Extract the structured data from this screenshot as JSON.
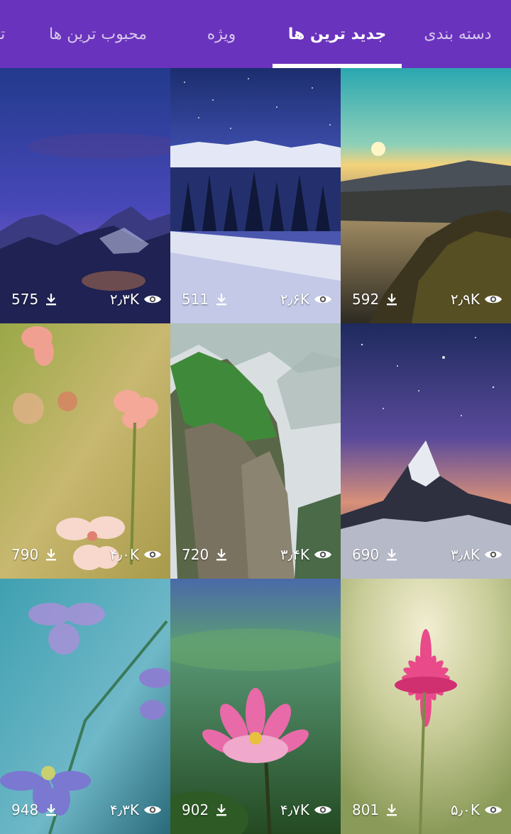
{
  "tabs": [
    {
      "label": "دسته بندی",
      "active": false
    },
    {
      "label": "جدید ترین ها",
      "active": true
    },
    {
      "label": "ویژه",
      "active": false
    },
    {
      "label": "محبوب ترین ها",
      "active": false
    },
    {
      "label": "تـ",
      "active": false
    }
  ],
  "colors": {
    "tab_bar": "#6a33bd",
    "indicator": "#ffffff"
  },
  "wallpapers": [
    {
      "subject": "purple night sky over mountain peaks",
      "downloads": "575",
      "views": "۲٫۳K",
      "download_icon": "download-icon",
      "view_icon": "eye-icon"
    },
    {
      "subject": "starry sky over snowy pine forest",
      "downloads": "511",
      "views": "۲٫۶K",
      "download_icon": "download-icon",
      "view_icon": "eye-icon"
    },
    {
      "subject": "sunrise over valley and mountains",
      "downloads": "592",
      "views": "۲٫۹K",
      "download_icon": "download-icon",
      "view_icon": "eye-icon"
    },
    {
      "subject": "pink flowers on green-yellow bokeh",
      "downloads": "790",
      "views": "۴٫۰K",
      "download_icon": "download-icon",
      "view_icon": "eye-icon"
    },
    {
      "subject": "misty green cliff peaks",
      "downloads": "720",
      "views": "۳٫۴K",
      "download_icon": "download-icon",
      "view_icon": "eye-icon"
    },
    {
      "subject": "matterhorn under starry night",
      "downloads": "690",
      "views": "۳٫۸K",
      "download_icon": "download-icon",
      "view_icon": "eye-icon"
    },
    {
      "subject": "purple wildflowers on teal background",
      "downloads": "948",
      "views": "۴٫۳K",
      "download_icon": "download-icon",
      "view_icon": "eye-icon"
    },
    {
      "subject": "pink lotus flower with green background",
      "downloads": "902",
      "views": "۴٫۷K",
      "download_icon": "download-icon",
      "view_icon": "eye-icon"
    },
    {
      "subject": "magenta daisy on soft green bokeh",
      "downloads": "801",
      "views": "۵٫۰K",
      "download_icon": "download-icon",
      "view_icon": "eye-icon"
    }
  ]
}
